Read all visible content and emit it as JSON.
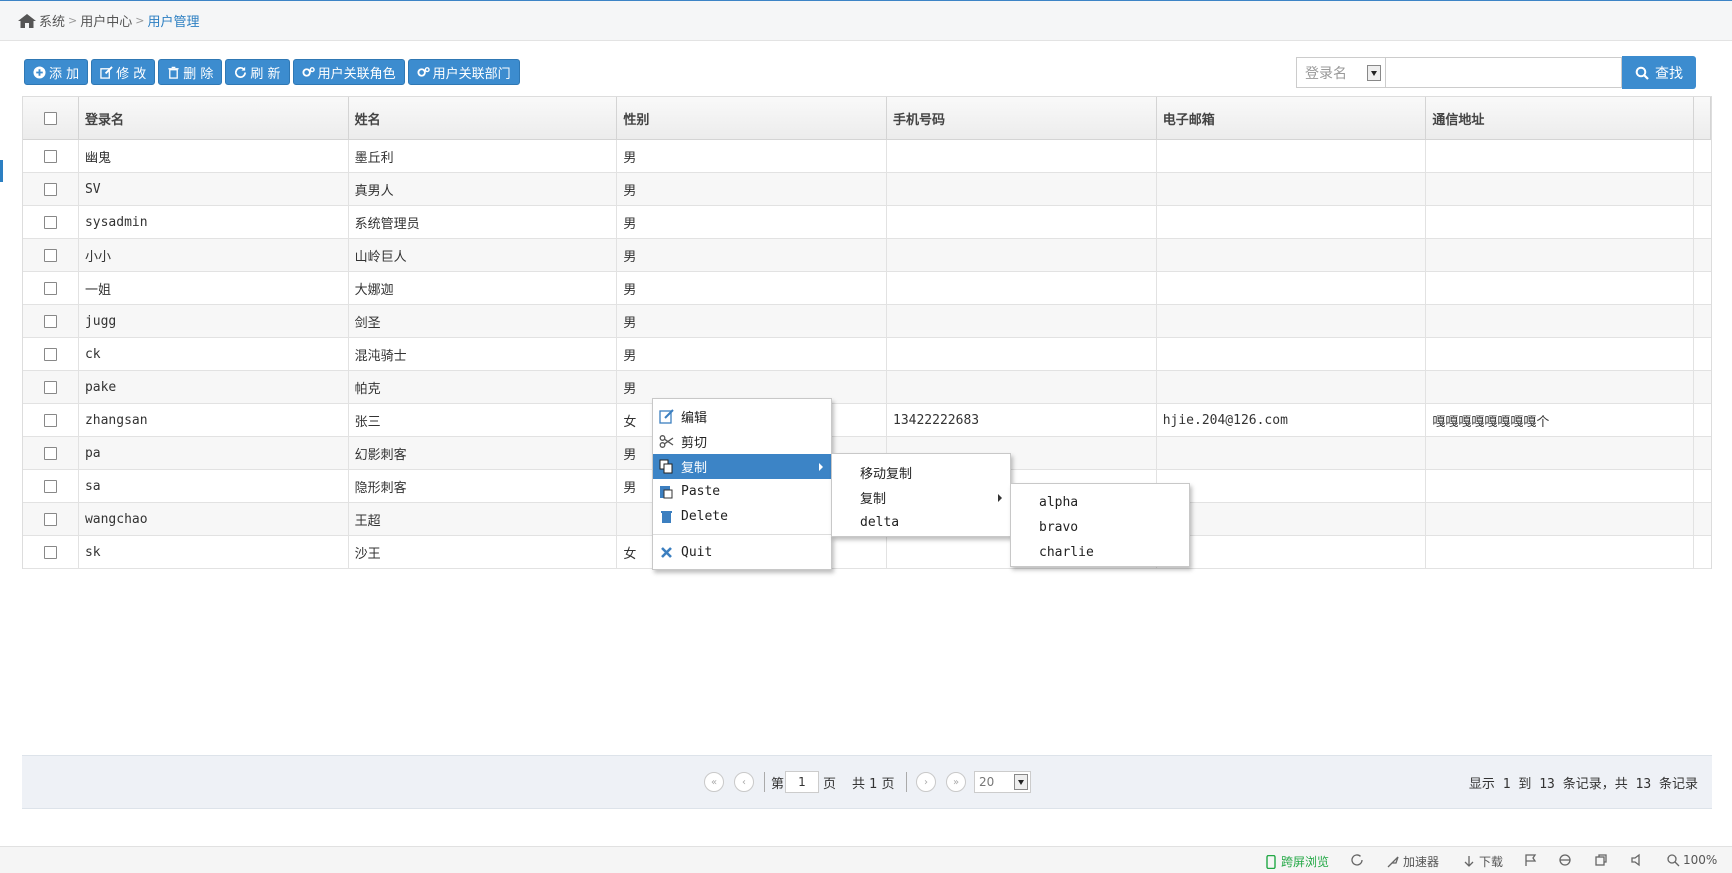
{
  "breadcrumb": {
    "items": [
      "系统",
      "用户中心",
      "用户管理"
    ]
  },
  "toolbar": {
    "add": "添 加",
    "edit": "修 改",
    "delete": "删 除",
    "refresh": "刷 新",
    "role": "用户关联角色",
    "dept": "用户关联部门"
  },
  "search": {
    "field": "登录名",
    "value": "",
    "button": "查找"
  },
  "table": {
    "headers": [
      "登录名",
      "姓名",
      "性别",
      "手机号码",
      "电子邮箱",
      "通信地址"
    ],
    "rows": [
      [
        "幽鬼",
        "墨丘利",
        "男",
        "",
        "",
        ""
      ],
      [
        "SV",
        "真男人",
        "男",
        "",
        "",
        ""
      ],
      [
        "sysadmin",
        "系统管理员",
        "男",
        "",
        "",
        ""
      ],
      [
        "小小",
        "山岭巨人",
        "男",
        "",
        "",
        ""
      ],
      [
        "一姐",
        "大娜迦",
        "男",
        "",
        "",
        ""
      ],
      [
        "jugg",
        "剑圣",
        "男",
        "",
        "",
        ""
      ],
      [
        "ck",
        "混沌骑士",
        "男",
        "",
        "",
        ""
      ],
      [
        "pake",
        "帕克",
        "男",
        "",
        "",
        ""
      ],
      [
        "zhangsan",
        "张三",
        "女",
        "13422222683",
        "hjie.204@126.com",
        "嘎嘎嘎嘎嘎嘎嘎嘎个"
      ],
      [
        "pa",
        "幻影刺客",
        "男",
        "",
        "",
        ""
      ],
      [
        "sa",
        "隐形刺客",
        "男",
        "",
        "",
        ""
      ],
      [
        "wangchao",
        "王超",
        "",
        "",
        "",
        ""
      ],
      [
        "sk",
        "沙王",
        "女",
        "",
        "",
        ""
      ]
    ]
  },
  "pager": {
    "page_prefix": "第",
    "page": "1",
    "page_suffix": "页",
    "total_pages": "共 1 页",
    "page_size": "20",
    "info": "显示 1 到 13 条记录，共 13 条记录"
  },
  "context_menu": {
    "items": [
      "编辑",
      "剪切",
      "复制",
      "Paste",
      "Delete",
      "Quit"
    ],
    "submenu1": [
      "移动复制",
      "复制",
      "delta"
    ],
    "submenu2": [
      "alpha",
      "bravo",
      "charlie"
    ]
  },
  "statusbar": {
    "cross_screen": "跨屏浏览",
    "accelerator": "加速器",
    "download": "下载",
    "zoom": "100%"
  },
  "colors": {
    "accent": "#3c8ccf",
    "highlight": "#3c84c6",
    "green": "#22a845"
  },
  "icons": [
    "home-icon",
    "plus-circle-icon",
    "edit-icon",
    "trash-icon",
    "refresh-icon",
    "gears-icon",
    "search-icon",
    "scissors-icon",
    "copy-icon",
    "paste-icon",
    "delete-icon",
    "close-icon"
  ]
}
